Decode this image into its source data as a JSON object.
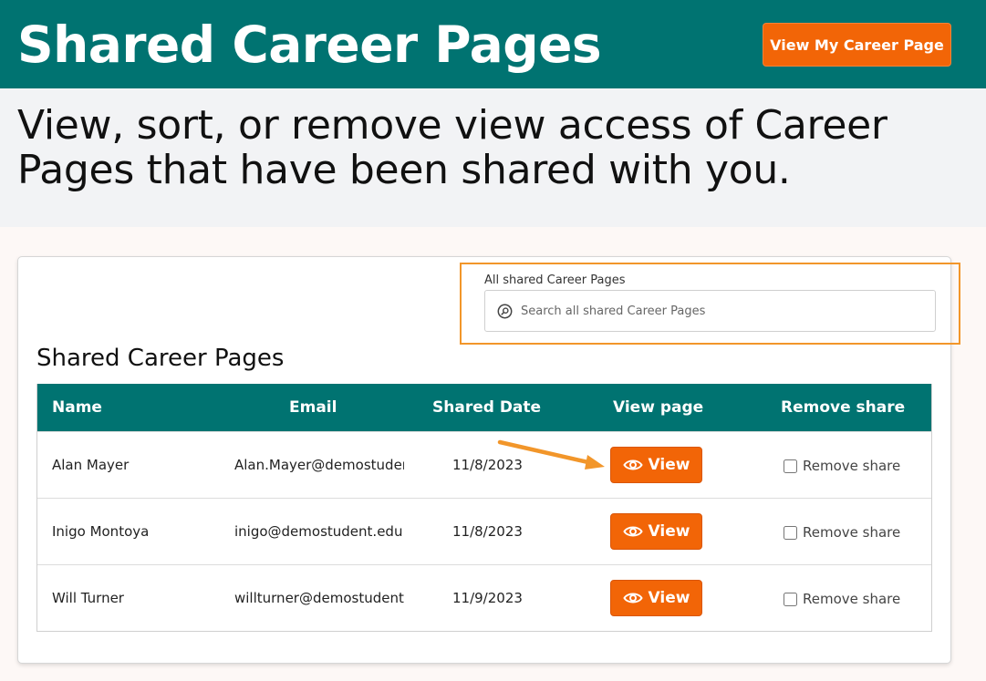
{
  "header": {
    "title": "Shared Career Pages",
    "my_page_button": "View My Career Page"
  },
  "subheader": {
    "description": "View, sort, or remove view access of Career Pages that have been shared with you."
  },
  "search": {
    "label": "All shared Career Pages",
    "placeholder": "Search all shared Career Pages",
    "icon": "search-icon"
  },
  "section_title": "Shared Career Pages",
  "table": {
    "columns": [
      "Name",
      "Email",
      "Shared Date",
      "View page",
      "Remove share"
    ],
    "rows": [
      {
        "name": "Alan Mayer",
        "email": "Alan.Mayer@demostudent.edu",
        "date": "11/8/2023",
        "view": "View",
        "remove": "Remove share"
      },
      {
        "name": "Inigo Montoya",
        "email": "inigo@demostudent.edu",
        "date": "11/8/2023",
        "view": "View",
        "remove": "Remove share"
      },
      {
        "name": "Will Turner",
        "email": "willturner@demostudent.edu",
        "date": "11/9/2023",
        "view": "View",
        "remove": "Remove share"
      }
    ]
  },
  "colors": {
    "teal": "#007371",
    "orange": "#f26507",
    "highlight": "#f2962a"
  }
}
